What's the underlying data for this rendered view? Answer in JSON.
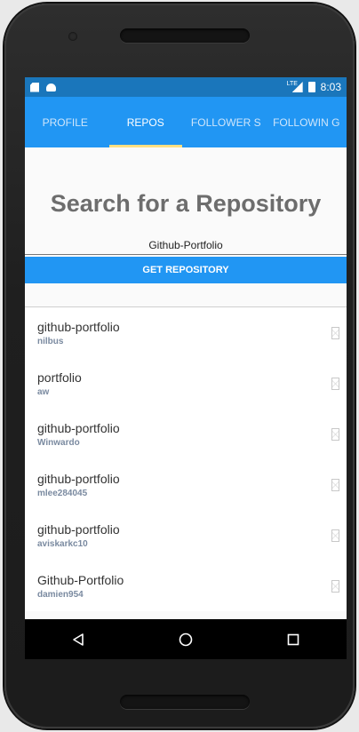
{
  "status_bar": {
    "network": "LTE",
    "time": "8:03"
  },
  "tabs": [
    {
      "label": "PROFILE",
      "active": false
    },
    {
      "label": "REPOS",
      "active": true
    },
    {
      "label": "FOLLOWER S",
      "active": false
    },
    {
      "label": "FOLLOWIN G",
      "active": false
    }
  ],
  "search": {
    "title": "Search for a Repository",
    "query": "Github-Portfolio",
    "button_label": "GET REPOSITORY"
  },
  "repos": [
    {
      "name": "github-portfolio",
      "owner": "nilbus"
    },
    {
      "name": "portfolio",
      "owner": "aw"
    },
    {
      "name": "github-portfolio",
      "owner": "Winwardo"
    },
    {
      "name": "github-portfolio",
      "owner": "mlee284045"
    },
    {
      "name": "github-portfolio",
      "owner": "aviskarkc10"
    },
    {
      "name": "Github-Portfolio",
      "owner": "damien954"
    }
  ],
  "nav": {
    "back_icon": "back-triangle-icon",
    "home_icon": "home-circle-icon",
    "recents_icon": "recents-square-icon"
  },
  "colors": {
    "status_bar": "#1a76bb",
    "tab_bar": "#2196f3",
    "tab_indicator": "#ffe082",
    "button": "#2196f3"
  }
}
